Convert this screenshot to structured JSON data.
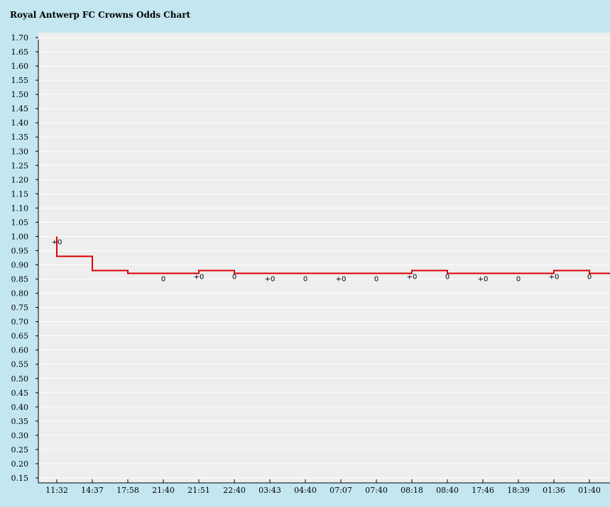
{
  "chart_data": {
    "type": "line",
    "title": "Royal Antwerp FC Crowns Odds Chart",
    "xlabel": "",
    "ylabel": "",
    "ylim": [
      0.15,
      1.7
    ],
    "y_tick_step": 0.05,
    "grid": true,
    "legend": "none",
    "step": true,
    "categories": [
      "11:32",
      "14:37",
      "17:58",
      "21:40",
      "21:51",
      "22:40",
      "03:43",
      "04:40",
      "07:07",
      "07:40",
      "08:18",
      "08:40",
      "17:46",
      "18:39",
      "01:36",
      "01:40"
    ],
    "series": [
      {
        "color": "#dd0000",
        "start_value": 1.0,
        "values": [
          0.93,
          0.88,
          0.87,
          0.87,
          0.88,
          0.87,
          0.87,
          0.87,
          0.87,
          0.87,
          0.88,
          0.87,
          0.87,
          0.87,
          0.88,
          0.87
        ],
        "point_labels": [
          "+0",
          "",
          "",
          "0",
          "+0",
          "0",
          "+0",
          "0",
          "+0",
          "0",
          "+0",
          "0",
          "+0",
          "0",
          "+0",
          "0"
        ]
      }
    ]
  },
  "colors": {
    "background": "#c3e6f1",
    "plot_background": "#eeeeee",
    "gridline": "#ffffff",
    "axis": "#000000"
  }
}
